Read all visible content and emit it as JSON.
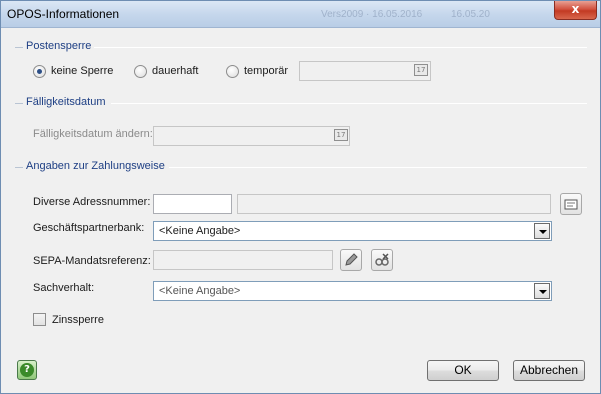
{
  "window": {
    "title": "OPOS-Informationen",
    "background_titles": [
      "Vers2009 · 16.05.2016",
      "16.05.20"
    ],
    "close_glyph": "x"
  },
  "postensperre": {
    "title": "Postensperre",
    "options": [
      {
        "label": "keine Sperre",
        "selected": true
      },
      {
        "label": "dauerhaft",
        "selected": false
      },
      {
        "label": "temporär",
        "selected": false
      }
    ],
    "date_value": "",
    "calendar_icon": "calendar-icon"
  },
  "faelligkeit": {
    "title": "Fälligkeitsdatum",
    "label": "Fälligkeitsdatum ändern:",
    "date_value": ""
  },
  "zahlungsweise": {
    "title": "Angaben zur Zahlungsweise",
    "adress_label": "Diverse Adressnummer:",
    "adress_value": "",
    "adress_name": "",
    "bank_label": "Geschäftspartnerbank:",
    "bank_value": "<Keine Angabe>",
    "sepa_label": "SEPA-Mandatsreferenz:",
    "sepa_value": "",
    "sachverhalt_label": "Sachverhalt:",
    "sachverhalt_value": "<Keine Angabe>",
    "zinssperre_label": "Zinssperre",
    "zinssperre_checked": false
  },
  "buttons": {
    "ok": "OK",
    "cancel": "Abbrechen",
    "help": "?"
  }
}
